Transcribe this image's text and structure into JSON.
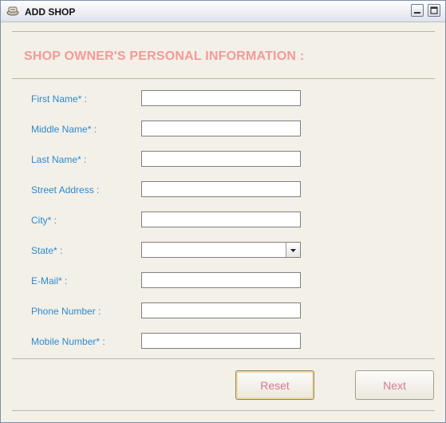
{
  "window": {
    "title": "ADD SHOP"
  },
  "form": {
    "heading": "SHOP OWNER'S PERSONAL INFORMATION :",
    "fields": [
      {
        "label": "First Name* :",
        "value": ""
      },
      {
        "label": "Middle Name* :",
        "value": ""
      },
      {
        "label": "Last Name* :",
        "value": ""
      },
      {
        "label": "Street Address :",
        "value": ""
      },
      {
        "label": "City* :",
        "value": ""
      },
      {
        "label": "State* :",
        "value": ""
      },
      {
        "label": "E-Mail* :",
        "value": ""
      },
      {
        "label": "Phone Number :",
        "value": ""
      },
      {
        "label": "Mobile Number* :",
        "value": ""
      }
    ]
  },
  "buttons": {
    "reset_label": "Reset",
    "next_label": "Next"
  },
  "colors": {
    "heading": "#f49a98",
    "label": "#2d8ad0",
    "button_text": "#d9788f",
    "background": "#f3f0e8"
  },
  "icons": {
    "app": "shop-app-icon",
    "minimize": "minimize-icon",
    "maximize": "maximize-icon",
    "dropdown": "chevron-down-icon"
  }
}
